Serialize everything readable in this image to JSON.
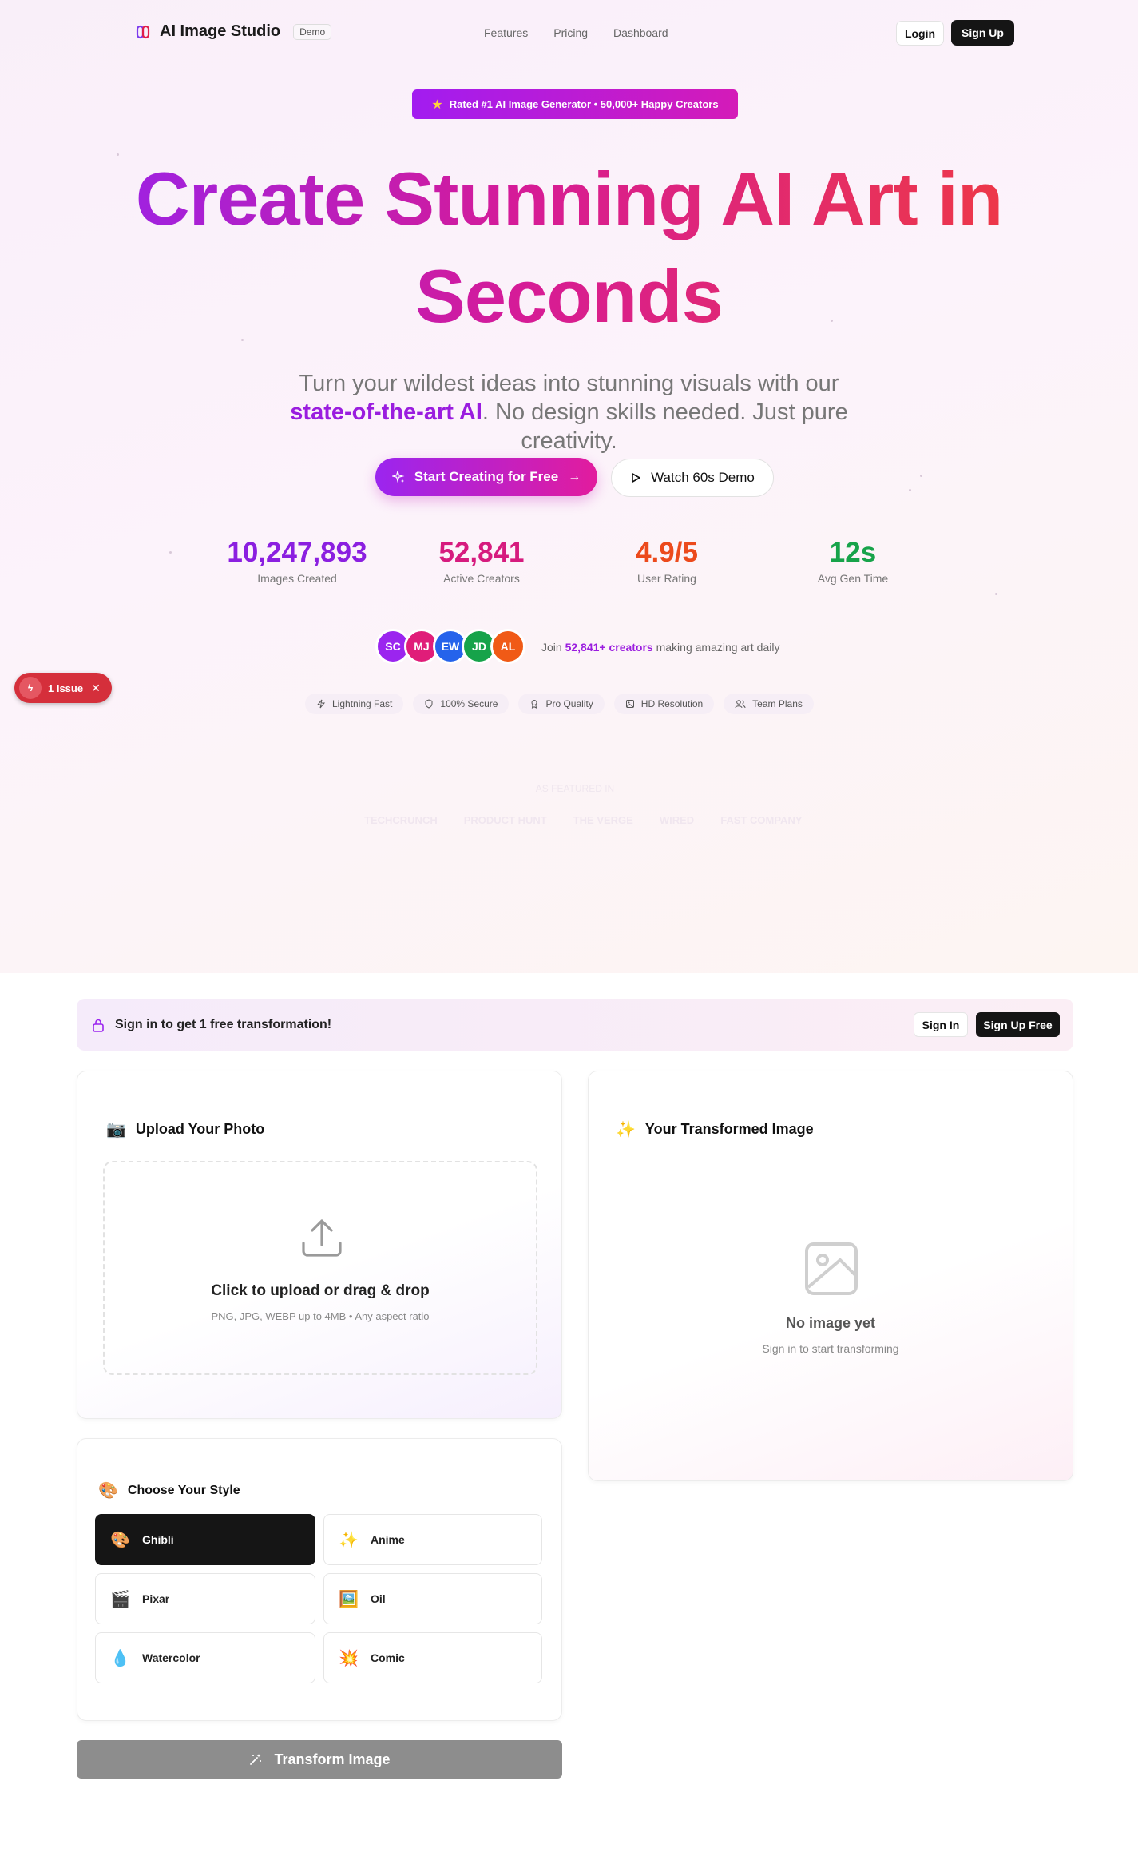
{
  "header": {
    "brand": "AI Image Studio",
    "badge": "Demo",
    "nav": [
      "Features",
      "Pricing",
      "Dashboard"
    ],
    "login": "Login",
    "signup": "Sign Up"
  },
  "hero": {
    "rated": "Rated #1 AI Image Generator • 50,000+ Happy Creators",
    "headline_line1": "Create Stunning AI Art in",
    "headline_line2": "Seconds",
    "subtitle_before": "Turn your wildest ideas into stunning visuals with our ",
    "subtitle_highlight": "state-of-the-art AI",
    "subtitle_after": ". No design skills needed. Just pure creativity.",
    "cta_primary": "Start Creating for Free",
    "cta_secondary": "Watch 60s Demo"
  },
  "stats": [
    {
      "value": "10,247,893",
      "label": "Images Created",
      "color": "#8b1fe0"
    },
    {
      "value": "52,841",
      "label": "Active Creators",
      "color": "#d61b7e"
    },
    {
      "value": "4.9/5",
      "label": "User Rating",
      "color": "#ec4a1c"
    },
    {
      "value": "12s",
      "label": "Avg Gen Time",
      "color": "#17a34a"
    }
  ],
  "social": {
    "avatars": [
      {
        "initials": "SC",
        "color": "#9b25ef"
      },
      {
        "initials": "MJ",
        "color": "#e01d79"
      },
      {
        "initials": "EW",
        "color": "#2563eb"
      },
      {
        "initials": "JD",
        "color": "#16a34a"
      },
      {
        "initials": "AL",
        "color": "#f05a16"
      }
    ],
    "join_prefix": "Join ",
    "join_highlight": "52,841+ creators",
    "join_suffix": " making amazing art daily"
  },
  "chips": [
    {
      "icon": "lightning-icon",
      "label": "Lightning Fast"
    },
    {
      "icon": "shield-icon",
      "label": "100% Secure"
    },
    {
      "icon": "award-icon",
      "label": "Pro Quality"
    },
    {
      "icon": "image-icon",
      "label": "HD Resolution"
    },
    {
      "icon": "users-icon",
      "label": "Team Plans"
    }
  ],
  "issue_badge": "1 Issue",
  "featured": {
    "label": "AS FEATURED IN",
    "outlets": [
      "TECHCRUNCH",
      "PRODUCT HUNT",
      "THE VERGE",
      "WIRED",
      "FAST COMPANY"
    ]
  },
  "signin_bar": {
    "text": "Sign in to get 1 free transformation!",
    "signin": "Sign In",
    "signup": "Sign Up Free"
  },
  "upload": {
    "title": "Upload Your Photo",
    "main": "Click to upload or drag & drop",
    "sub": "PNG, JPG, WEBP up to 4MB • Any aspect ratio"
  },
  "result": {
    "title": "Your Transformed Image",
    "empty_title": "No image yet",
    "empty_sub": "Sign in to start transforming"
  },
  "styles": {
    "title": "Choose Your Style",
    "selected": "Ghibli",
    "options": [
      {
        "label": "Ghibli",
        "emoji": "🎨"
      },
      {
        "label": "Anime",
        "emoji": "✨"
      },
      {
        "label": "Pixar",
        "emoji": "🎬"
      },
      {
        "label": "Oil",
        "emoji": "🖼️"
      },
      {
        "label": "Watercolor",
        "emoji": "💧"
      },
      {
        "label": "Comic",
        "emoji": "💥"
      }
    ]
  },
  "transform_button": "Transform Image"
}
